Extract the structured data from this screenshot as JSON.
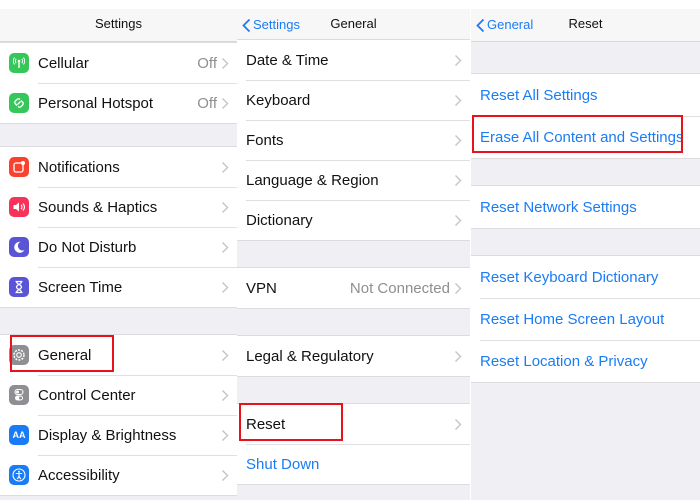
{
  "panels": {
    "settings": {
      "title": "Settings",
      "groups": [
        [
          {
            "icon": "cellular-icon",
            "label": "Cellular",
            "value": "Off",
            "color": "#35c759"
          },
          {
            "icon": "personal-hotspot-icon",
            "label": "Personal Hotspot",
            "value": "Off",
            "color": "#35c759"
          }
        ],
        [
          {
            "icon": "notifications-icon",
            "label": "Notifications",
            "color": "#f8412f"
          },
          {
            "icon": "sounds-icon",
            "label": "Sounds & Haptics",
            "color": "#f8335a"
          },
          {
            "icon": "moon-icon",
            "label": "Do Not Disturb",
            "color": "#5a55d6"
          },
          {
            "icon": "hourglass-icon",
            "label": "Screen Time",
            "color": "#5a55d6"
          }
        ],
        [
          {
            "icon": "gear-icon",
            "label": "General",
            "color": "#8e8e93",
            "highlighted": true
          },
          {
            "icon": "toggles-icon",
            "label": "Control Center",
            "color": "#8e8e93"
          },
          {
            "icon": "display-icon",
            "label": "Display & Brightness",
            "icon_text": "AA",
            "color": "#1a7cf5"
          },
          {
            "icon": "accessibility-icon",
            "label": "Accessibility",
            "color": "#1a7cf5"
          }
        ]
      ]
    },
    "general": {
      "back": "Settings",
      "title": "General",
      "groups": [
        [
          {
            "label": "Date & Time"
          },
          {
            "label": "Keyboard"
          },
          {
            "label": "Fonts"
          },
          {
            "label": "Language & Region"
          },
          {
            "label": "Dictionary"
          }
        ],
        [
          {
            "label": "VPN",
            "value": "Not Connected"
          }
        ],
        [
          {
            "label": "Legal & Regulatory"
          }
        ],
        [
          {
            "label": "Reset",
            "highlighted": true
          },
          {
            "label": "Shut Down",
            "action": true
          }
        ]
      ]
    },
    "reset": {
      "back": "General",
      "title": "Reset",
      "groups": [
        [
          {
            "label": "Reset All Settings"
          },
          {
            "label": "Erase All Content and Settings",
            "highlighted": true
          }
        ],
        [
          {
            "label": "Reset Network Settings"
          }
        ],
        [
          {
            "label": "Reset Keyboard Dictionary"
          },
          {
            "label": "Reset Home Screen Layout"
          },
          {
            "label": "Reset Location & Privacy"
          }
        ]
      ]
    }
  },
  "colors": {
    "accent": "#1a7cf5",
    "highlight": "#e8121a",
    "background": "#efeff4"
  }
}
